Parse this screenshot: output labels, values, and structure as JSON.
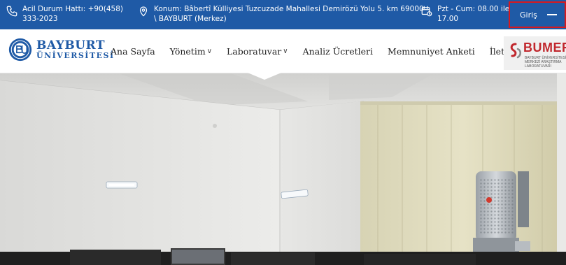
{
  "topbar": {
    "emergency": {
      "icon": "phone-icon",
      "text": "Acil Durum Hattı: +90(458)\n333-2023"
    },
    "location": {
      "icon": "location-pin-icon",
      "text": "Konum: Bâbertî Külliyesi Tuzcuzade Mahallesi Demirözü Yolu 5. km 69000\n\\ BAYBURT (Merkez)"
    },
    "hours": {
      "icon": "calendar-clock-icon",
      "text": "Pzt - Cum: 08.00 ile\n17.00"
    },
    "login_label": "Giriş"
  },
  "nav": {
    "logo": {
      "line1": "BAYBURT",
      "line2": "ÜNİVERSİTESİ"
    },
    "items": [
      {
        "label": "Ana Sayfa",
        "dropdown": false
      },
      {
        "label": "Yönetim",
        "dropdown": true
      },
      {
        "label": "Laboratuvar",
        "dropdown": true
      },
      {
        "label": "Analiz Ücretleri",
        "dropdown": false
      },
      {
        "label": "Memnuniyet Anketi",
        "dropdown": false
      },
      {
        "label": "İletişim",
        "dropdown": false
      }
    ],
    "bumer": {
      "name": "BUMER",
      "sub": "BAYBURT ÜNİVERSİTESİ MERKEZİ ARAŞTIRMA LABORATUVARI"
    }
  },
  "colors": {
    "topbar": "#1f5aa6",
    "highlight": "#d7191f",
    "brand": "#1f5aa6",
    "bumer_red": "#c1272d"
  }
}
